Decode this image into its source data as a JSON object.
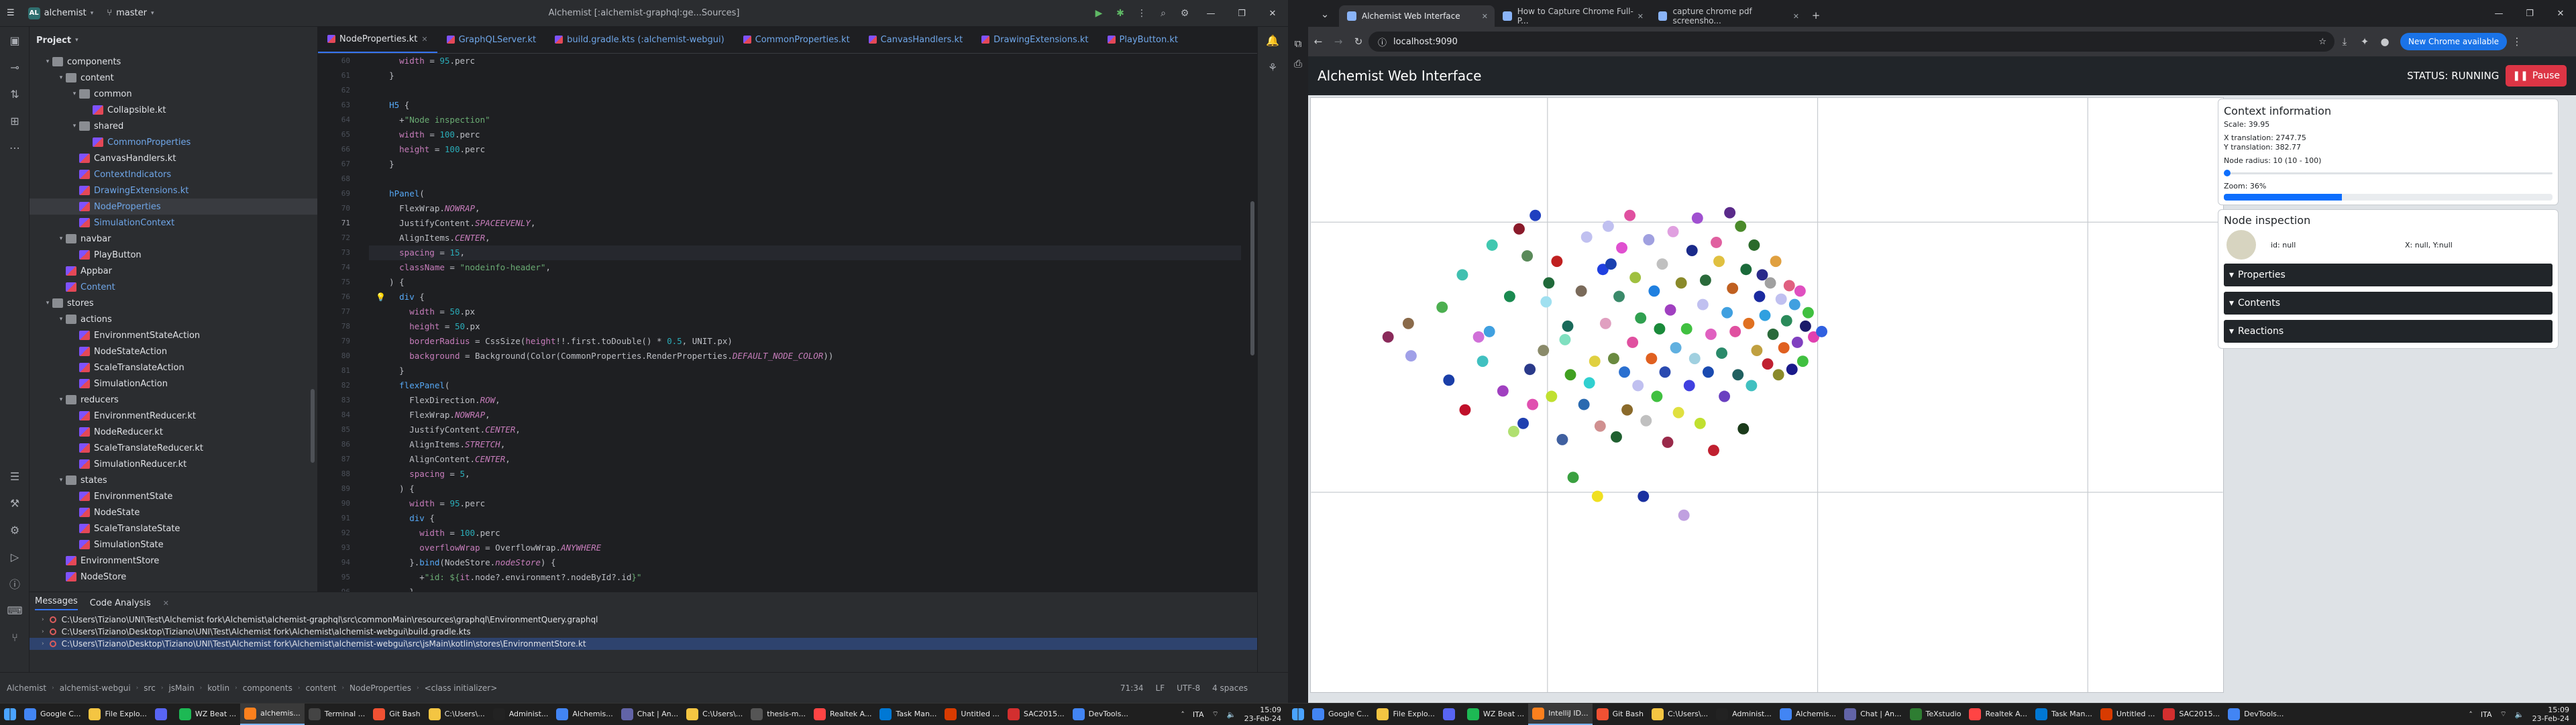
{
  "ide": {
    "project_name": "alchemist",
    "project_badge": "AL",
    "branch": "master",
    "window_title": "Alchemist [:alchemist-graphql:ge...Sources]",
    "project_panel_title": "Project",
    "tree": [
      {
        "label": "components",
        "depth": 3,
        "kind": "folder",
        "open": true
      },
      {
        "label": "content",
        "depth": 4,
        "kind": "folder",
        "open": true
      },
      {
        "label": "common",
        "depth": 5,
        "kind": "folder",
        "open": true
      },
      {
        "label": "Collapsible.kt",
        "depth": 6,
        "kind": "kt"
      },
      {
        "label": "shared",
        "depth": 5,
        "kind": "folder",
        "open": true
      },
      {
        "label": "CommonProperties",
        "depth": 6,
        "kind": "kt",
        "color": "#6fa6e8"
      },
      {
        "label": "CanvasHandlers.kt",
        "depth": 5,
        "kind": "kt"
      },
      {
        "label": "ContextIndicators",
        "depth": 5,
        "kind": "kt",
        "color": "#6fa6e8"
      },
      {
        "label": "DrawingExtensions.kt",
        "depth": 5,
        "kind": "kt",
        "color": "#6fa6e8"
      },
      {
        "label": "NodeProperties",
        "depth": 5,
        "kind": "kt",
        "color": "#6fa6e8",
        "selected": true
      },
      {
        "label": "SimulationContext",
        "depth": 5,
        "kind": "kt",
        "color": "#6fa6e8"
      },
      {
        "label": "navbar",
        "depth": 4,
        "kind": "folder",
        "open": true
      },
      {
        "label": "PlayButton",
        "depth": 5,
        "kind": "kt"
      },
      {
        "label": "Appbar",
        "depth": 4,
        "kind": "kt"
      },
      {
        "label": "Content",
        "depth": 4,
        "kind": "kt",
        "color": "#6fa6e8"
      },
      {
        "label": "stores",
        "depth": 3,
        "kind": "folder",
        "open": true
      },
      {
        "label": "actions",
        "depth": 4,
        "kind": "folder",
        "open": true
      },
      {
        "label": "EnvironmentStateAction",
        "depth": 5,
        "kind": "kt"
      },
      {
        "label": "NodeStateAction",
        "depth": 5,
        "kind": "kt"
      },
      {
        "label": "ScaleTranslateAction",
        "depth": 5,
        "kind": "kt"
      },
      {
        "label": "SimulationAction",
        "depth": 5,
        "kind": "kt"
      },
      {
        "label": "reducers",
        "depth": 4,
        "kind": "folder",
        "open": true
      },
      {
        "label": "EnvironmentReducer.kt",
        "depth": 5,
        "kind": "kt"
      },
      {
        "label": "NodeReducer.kt",
        "depth": 5,
        "kind": "kt"
      },
      {
        "label": "ScaleTranslateReducer.kt",
        "depth": 5,
        "kind": "kt"
      },
      {
        "label": "SimulationReducer.kt",
        "depth": 5,
        "kind": "kt"
      },
      {
        "label": "states",
        "depth": 4,
        "kind": "folder",
        "open": true
      },
      {
        "label": "EnvironmentState",
        "depth": 5,
        "kind": "kt"
      },
      {
        "label": "NodeState",
        "depth": 5,
        "kind": "kt"
      },
      {
        "label": "ScaleTranslateState",
        "depth": 5,
        "kind": "kt"
      },
      {
        "label": "SimulationState",
        "depth": 5,
        "kind": "kt"
      },
      {
        "label": "EnvironmentStore",
        "depth": 4,
        "kind": "kt"
      },
      {
        "label": "NodeStore",
        "depth": 4,
        "kind": "kt"
      }
    ],
    "tabs": [
      {
        "label": "NodeProperties.kt",
        "active": true
      },
      {
        "label": "GraphQLServer.kt",
        "active": false
      },
      {
        "label": "build.gradle.kts (:alchemist-webgui)",
        "active": false
      },
      {
        "label": "CommonProperties.kt",
        "active": false
      },
      {
        "label": "CanvasHandlers.kt",
        "active": false
      },
      {
        "label": "DrawingExtensions.kt",
        "active": false
      },
      {
        "label": "PlayButton.kt",
        "active": false
      }
    ],
    "first_line_number": 60,
    "current_line_number": 71,
    "messages_tabs": [
      "Messages",
      "Code Analysis"
    ],
    "messages": [
      "C:\\Users\\Tiziano\\UNI\\Test\\Alchemist fork\\Alchemist\\alchemist-graphql\\src\\commonMain\\resources\\graphql\\EnvironmentQuery.graphql",
      "C:\\Users\\Tiziano\\Desktop\\Tiziano\\UNI\\Test\\Alchemist fork\\Alchemist\\alchemist-webgui\\build.gradle.kts",
      "C:\\Users\\Tiziano\\Desktop\\Tiziano\\UNI\\Test\\Alchemist fork\\Alchemist\\alchemist-webgui\\src\\jsMain\\kotlin\\stores\\EnvironmentStore.kt"
    ],
    "breadcrumb": [
      "Alchemist",
      "alchemist-webgui",
      "src",
      "jsMain",
      "kotlin",
      "components",
      "content",
      "NodeProperties",
      "<class initializer>"
    ],
    "status_right": [
      "71:34",
      "LF",
      "UTF-8",
      "4 spaces"
    ]
  },
  "taskbar_left": [
    {
      "label": "Google C...",
      "color": "#4285f4"
    },
    {
      "label": "File Explo...",
      "color": "#f4c542"
    },
    {
      "label": "",
      "color": "#5865f2"
    },
    {
      "label": "WZ Beat ...",
      "color": "#1db954"
    },
    {
      "label": "alchemis...",
      "color": "#fc801d",
      "active": true
    },
    {
      "label": "Terminal ...",
      "color": "#444"
    },
    {
      "label": "Git Bash",
      "color": "#f05133"
    },
    {
      "label": "C:\\Users\\...",
      "color": "#f4c542"
    },
    {
      "label": "Administ...",
      "color": "#222"
    },
    {
      "label": "Alchemis...",
      "color": "#4285f4"
    },
    {
      "label": "Chat | An...",
      "color": "#6264a7"
    },
    {
      "label": "C:\\Users\\...",
      "color": "#f4c542"
    },
    {
      "label": "thesis-m...",
      "color": "#555"
    },
    {
      "label": "Realtek A...",
      "color": "#ff4444"
    },
    {
      "label": "Task Man...",
      "color": "#0078d4"
    },
    {
      "label": "Untitled ...",
      "color": "#d83b01"
    },
    {
      "label": "SAC2015...",
      "color": "#d32f2f"
    },
    {
      "label": "DevTools...",
      "color": "#4285f4"
    }
  ],
  "taskbar_right": [
    {
      "label": "Google C...",
      "color": "#4285f4"
    },
    {
      "label": "File Explo...",
      "color": "#f4c542"
    },
    {
      "label": "",
      "color": "#5865f2"
    },
    {
      "label": "WZ Beat ...",
      "color": "#1db954"
    },
    {
      "label": "IntelliJ ID...",
      "color": "#fc801d",
      "active": true
    },
    {
      "label": "Git Bash",
      "color": "#f05133"
    },
    {
      "label": "C:\\Users\\...",
      "color": "#f4c542"
    },
    {
      "label": "Administ...",
      "color": "#222"
    },
    {
      "label": "Alchemis...",
      "color": "#4285f4"
    },
    {
      "label": "Chat | An...",
      "color": "#6264a7"
    },
    {
      "label": "TeXstudio",
      "color": "#2e7d32"
    },
    {
      "label": "Realtek A...",
      "color": "#ff4444"
    },
    {
      "label": "Task Man...",
      "color": "#0078d4"
    },
    {
      "label": "Untitled ...",
      "color": "#d83b01"
    },
    {
      "label": "SAC2015...",
      "color": "#d32f2f"
    },
    {
      "label": "DevTools...",
      "color": "#4285f4"
    }
  ],
  "clock": {
    "time": "15:09",
    "date": "23-Feb-24",
    "lang": "ITA"
  },
  "chrome": {
    "tabs": [
      {
        "label": "Alchemist Web Interface",
        "active": true
      },
      {
        "label": "How to Capture Chrome Full-P...",
        "active": false
      },
      {
        "label": "capture chrome pdf screensho...",
        "active": false
      }
    ],
    "url": "localhost:9090",
    "update_label": "New Chrome available"
  },
  "app": {
    "title": "Alchemist Web Interface",
    "status_label": "STATUS: RUNNING",
    "pause_label": "Pause",
    "context": {
      "title": "Context information",
      "scale": "Scale: 39.95",
      "x_translation": "X translation: 2747.75",
      "y_translation": "Y translation: 382.77",
      "node_radius": "Node radius: 10 (10 - 100)",
      "node_radius_level": 0.0,
      "zoom": "Zoom: 36%",
      "zoom_level": 0.36
    },
    "inspection": {
      "title": "Node inspection",
      "id": "id: null",
      "coords": "X: null, Y:null",
      "sections": [
        "Properties",
        "Contents",
        "Reactions"
      ]
    },
    "nodes": [
      [
        -205,
        0,
        "#8a2a5a"
      ],
      [
        -190,
        -10,
        "#8a6a4a"
      ],
      [
        -188,
        14,
        "#a0a0e8"
      ],
      [
        -165,
        -22,
        "#4caf50"
      ],
      [
        -160,
        32,
        "#1a3ea8"
      ],
      [
        -150,
        -46,
        "#40c0b0"
      ],
      [
        -148,
        54,
        "#c0102a"
      ],
      [
        -138,
        0,
        "#d070d8"
      ],
      [
        -135,
        18,
        "#40c0c0"
      ],
      [
        -130,
        -4,
        "#40a0e0"
      ],
      [
        -128,
        -68,
        "#40c8b0"
      ],
      [
        -120,
        40,
        "#a040c0"
      ],
      [
        -115,
        -30,
        "#1a8a50"
      ],
      [
        -112,
        70,
        "#b0e070"
      ],
      [
        -108,
        -80,
        "#8a1a2a"
      ],
      [
        -105,
        64,
        "#2040b0"
      ],
      [
        -102,
        -60,
        "#5a8a5a"
      ],
      [
        -100,
        24,
        "#2a3a8a"
      ],
      [
        -98,
        50,
        "#e050b0"
      ],
      [
        -96,
        -90,
        "#2040c0"
      ],
      [
        -90,
        10,
        "#8a8a6a"
      ],
      [
        -88,
        -26,
        "#a0e0f0"
      ],
      [
        -86,
        -40,
        "#206a3a"
      ],
      [
        -84,
        44,
        "#c0e030"
      ],
      [
        -80,
        -56,
        "#c02020"
      ],
      [
        -76,
        76,
        "#4060a0"
      ],
      [
        -74,
        2,
        "#80e0c0"
      ],
      [
        -72,
        -8,
        "#1a6a5a"
      ],
      [
        -70,
        28,
        "#40a020"
      ],
      [
        -68,
        104,
        "#3aa040"
      ],
      [
        -62,
        -34,
        "#7a6a5a"
      ],
      [
        -60,
        50,
        "#2a6ab0"
      ],
      [
        -58,
        -74,
        "#c0c0f0"
      ],
      [
        -56,
        34,
        "#30d0d0"
      ],
      [
        -52,
        18,
        "#e0d040"
      ],
      [
        -50,
        118,
        "#f0e020"
      ],
      [
        -48,
        66,
        "#d09090"
      ],
      [
        -46,
        -50,
        "#2040e0"
      ],
      [
        -44,
        -10,
        "#e0a0c0"
      ],
      [
        -42,
        -82,
        "#c0c0f0"
      ],
      [
        -40,
        -54,
        "#1a40b0"
      ],
      [
        -38,
        16,
        "#6a8a40"
      ],
      [
        -36,
        74,
        "#206030"
      ],
      [
        -34,
        -30,
        "#3a8a6a"
      ],
      [
        -32,
        -66,
        "#e050d0"
      ],
      [
        -30,
        26,
        "#2a70d0"
      ],
      [
        -28,
        54,
        "#8a6a2a"
      ],
      [
        -26,
        -90,
        "#e050a0"
      ],
      [
        -24,
        4,
        "#e050a0"
      ],
      [
        -22,
        -44,
        "#a0c040"
      ],
      [
        -20,
        36,
        "#c0c0f0"
      ],
      [
        -18,
        -14,
        "#30a050"
      ],
      [
        -16,
        118,
        "#1a30a0"
      ],
      [
        -14,
        62,
        "#c0c0c0"
      ],
      [
        -12,
        -72,
        "#a0a0e0"
      ],
      [
        -10,
        16,
        "#e06020"
      ],
      [
        -8,
        -34,
        "#2080e0"
      ],
      [
        -6,
        44,
        "#40c040"
      ],
      [
        -4,
        -6,
        "#1a8a3a"
      ],
      [
        -2,
        -54,
        "#c0c0c0"
      ],
      [
        0,
        26,
        "#2a4ab0"
      ],
      [
        2,
        78,
        "#9a2a4a"
      ],
      [
        4,
        -20,
        "#a040c0"
      ],
      [
        6,
        -78,
        "#e0a0e0"
      ],
      [
        8,
        8,
        "#60b0e0"
      ],
      [
        10,
        56,
        "#e0e040"
      ],
      [
        12,
        -40,
        "#8a8a2a"
      ],
      [
        14,
        132,
        "#c0a0e0"
      ],
      [
        16,
        -6,
        "#40c040"
      ],
      [
        18,
        36,
        "#4040e0"
      ],
      [
        20,
        -64,
        "#1a2a8a"
      ],
      [
        22,
        16,
        "#a0d0e0"
      ],
      [
        24,
        -88,
        "#a050d0"
      ],
      [
        26,
        64,
        "#c0e030"
      ],
      [
        28,
        -24,
        "#c0c0f0"
      ],
      [
        30,
        -42,
        "#2a6a3a"
      ],
      [
        32,
        26,
        "#1a4ab0"
      ],
      [
        34,
        -2,
        "#e060c0"
      ],
      [
        36,
        84,
        "#c02030"
      ],
      [
        38,
        -70,
        "#e060a0"
      ],
      [
        40,
        -56,
        "#e0c040"
      ],
      [
        42,
        12,
        "#2a8a6a"
      ],
      [
        44,
        44,
        "#6a40c0"
      ],
      [
        46,
        -18,
        "#40a0e0"
      ],
      [
        48,
        -92,
        "#5a2a8a"
      ],
      [
        50,
        -36,
        "#c06020"
      ],
      [
        52,
        -4,
        "#e050a0"
      ],
      [
        54,
        28,
        "#206060"
      ],
      [
        56,
        -82,
        "#4a8a2a"
      ],
      [
        58,
        68,
        "#1a3a1a"
      ],
      [
        60,
        -50,
        "#1a6a3a"
      ],
      [
        62,
        -10,
        "#e07020"
      ],
      [
        64,
        36,
        "#40c0c0"
      ],
      [
        66,
        -68,
        "#2a6a2a"
      ],
      [
        68,
        10,
        "#c0a040"
      ],
      [
        70,
        -30,
        "#1a2aa0"
      ],
      [
        72,
        -46,
        "#2a2a8a"
      ],
      [
        74,
        -16,
        "#30a0e0"
      ],
      [
        76,
        20,
        "#c02030"
      ],
      [
        78,
        -40,
        "#a0a0a0"
      ],
      [
        80,
        -2,
        "#2a6a3a"
      ],
      [
        82,
        -56,
        "#e0a040"
      ],
      [
        84,
        28,
        "#8a8a2a"
      ],
      [
        86,
        -28,
        "#c0c0f0"
      ],
      [
        88,
        8,
        "#e06020"
      ],
      [
        90,
        -12,
        "#2a8a5a"
      ],
      [
        92,
        -38,
        "#e06080"
      ],
      [
        94,
        24,
        "#1a1a8a"
      ],
      [
        96,
        -24,
        "#40a0e0"
      ],
      [
        98,
        4,
        "#8040c0"
      ],
      [
        100,
        -34,
        "#e050c0"
      ],
      [
        102,
        18,
        "#40c040"
      ],
      [
        104,
        -8,
        "#1a1a6a"
      ],
      [
        106,
        -18,
        "#40c040"
      ],
      [
        110,
        0,
        "#e040b0"
      ],
      [
        116,
        -4,
        "#3060e0"
      ]
    ]
  }
}
